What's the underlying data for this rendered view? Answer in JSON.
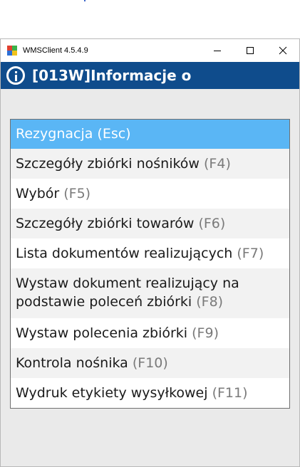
{
  "window": {
    "title": "WMSClient 4.5.4.9",
    "icon": "app-icon",
    "controls": [
      "minimize-icon",
      "maximize-icon",
      "close-icon"
    ]
  },
  "header": {
    "icon": "info-icon",
    "title": "[013W]Informacje o"
  },
  "menu": {
    "items": [
      {
        "label": "Rezygnacja",
        "key": "(Esc)",
        "selected": true
      },
      {
        "label": "Szczegóły zbiórki nośników",
        "key": "(F4)"
      },
      {
        "label": "Wybór",
        "key": "(F5)"
      },
      {
        "label": "Szczegóły zbiórki towarów",
        "key": "(F6)"
      },
      {
        "label": "Lista dokumentów realizujących",
        "key": "(F7)"
      },
      {
        "label": "Wystaw dokument realizujący na podstawie poleceń zbiórki",
        "key": "(F8)"
      },
      {
        "label": "Wystaw polecenia zbiórki",
        "key": "(F9)"
      },
      {
        "label": "Kontrola nośnika",
        "key": "(F10)"
      },
      {
        "label": "Wydruk etykiety wysyłkowej",
        "key": "(F11)"
      }
    ]
  },
  "colors": {
    "header_bg": "#0f4c8c",
    "selected_bg": "#5ab6f5",
    "shortcut_text": "#7a7a7a",
    "window_bg": "#eaeaea"
  }
}
